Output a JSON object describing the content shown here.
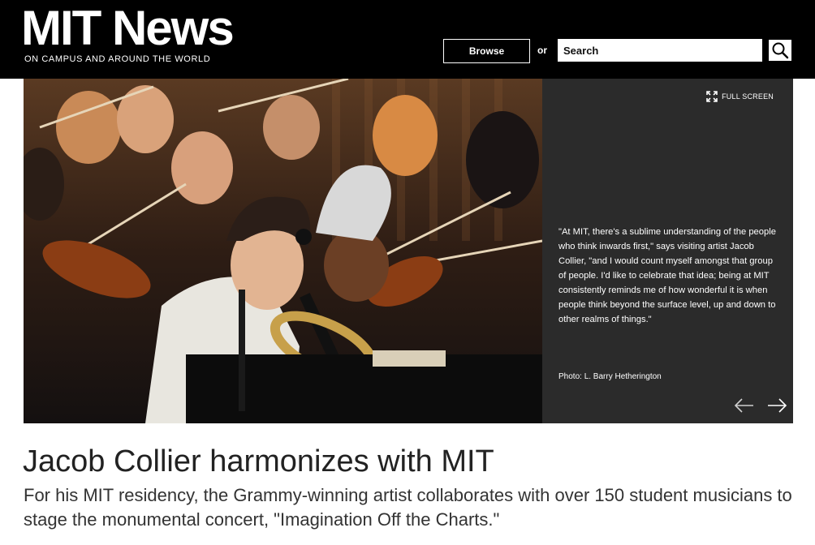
{
  "header": {
    "logo": "MIT News",
    "tagline": "ON CAMPUS AND AROUND THE WORLD",
    "browse_label": "Browse",
    "or_label": "or",
    "search_placeholder": "Search",
    "search_icon": "search-icon"
  },
  "slideshow": {
    "fullscreen_label": "FULL SCREEN",
    "quote": "\"At MIT, there's a sublime understanding of the people who think inwards first,\" says visiting artist Jacob Collier, \"and I would count myself amongst that group of people. I'd like to celebrate that idea; being at MIT consistently reminds me of how wonderful it is when people think beyond the surface level, up and down to other realms of things.\"",
    "photo_credit": "Photo: L. Barry Hetherington",
    "prev_icon": "arrow-left-icon",
    "next_icon": "arrow-right-icon"
  },
  "article": {
    "title": "Jacob Collier harmonizes with MIT",
    "subtitle": "For his MIT residency, the Grammy-winning artist collaborates with over 150 student musicians to stage the monumental concert, \"Imagination Off the Charts.\""
  },
  "colors": {
    "header_bg": "#000000",
    "caption_bg": "#2b2b2b",
    "text": "#222222"
  }
}
